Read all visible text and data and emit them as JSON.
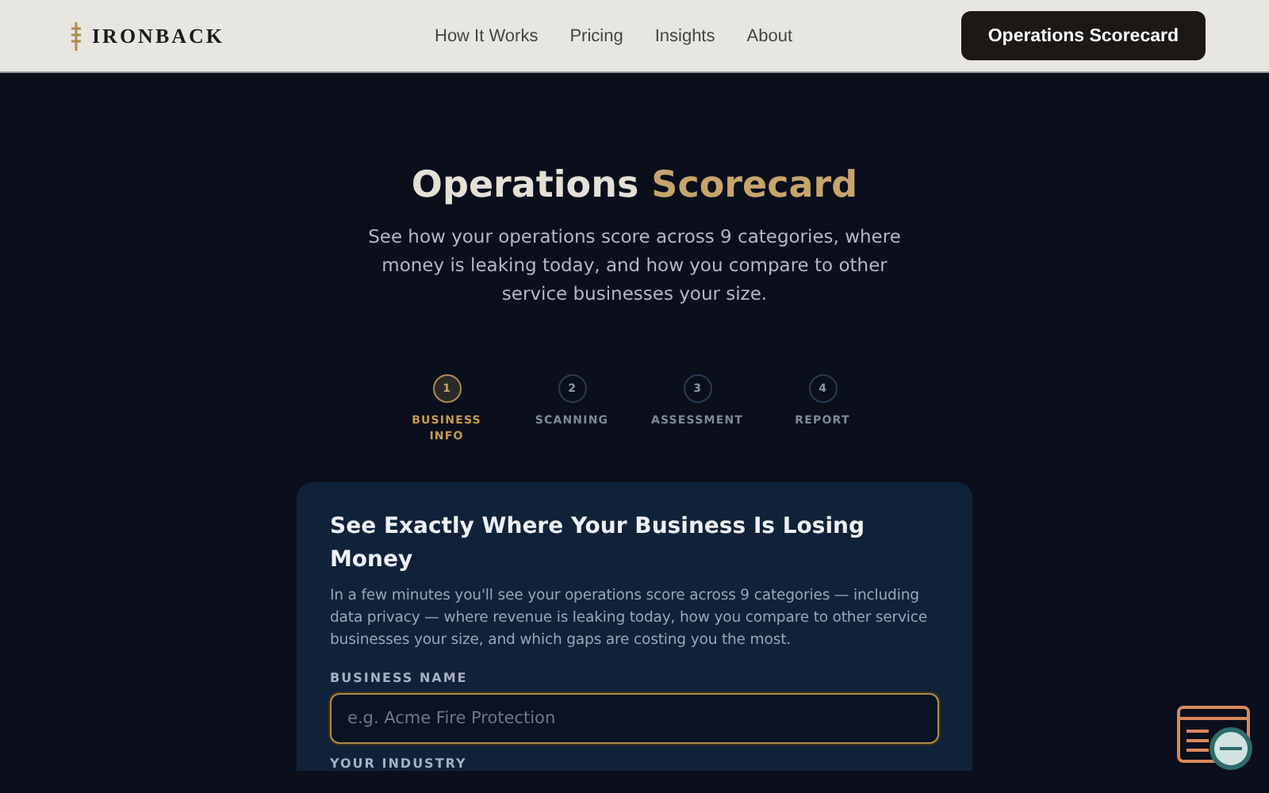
{
  "header": {
    "logo": "IRONBACK",
    "nav": [
      "How It Works",
      "Pricing",
      "Insights",
      "About"
    ],
    "cta": "Operations Scorecard"
  },
  "hero": {
    "title_start": "Operations",
    "title_accent": "Scorecard",
    "subtitle": "See how your operations score across 9 categories, where money is leaking today, and how you compare to other service businesses your size."
  },
  "steps": [
    {
      "number": "1",
      "label": "BUSINESS INFO",
      "selected": true
    },
    {
      "number": "2",
      "label": "SCANNING",
      "selected": false
    },
    {
      "number": "3",
      "label": "ASSESSMENT",
      "selected": false
    },
    {
      "number": "4",
      "label": "REPORT",
      "selected": false
    }
  ],
  "form": {
    "title": "See Exactly Where Your Business Is Losing Money",
    "intro": "In a few minutes you'll see your operations score across 9 categories — including data privacy — where revenue is leaking today, how you compare to other service businesses your size, and which gaps are costing you the most.",
    "fields": [
      {
        "label": "BUSINESS NAME",
        "placeholder": "e.g. Acme Fire Protection"
      }
    ],
    "next_label": "YOUR INDUSTRY"
  }
}
